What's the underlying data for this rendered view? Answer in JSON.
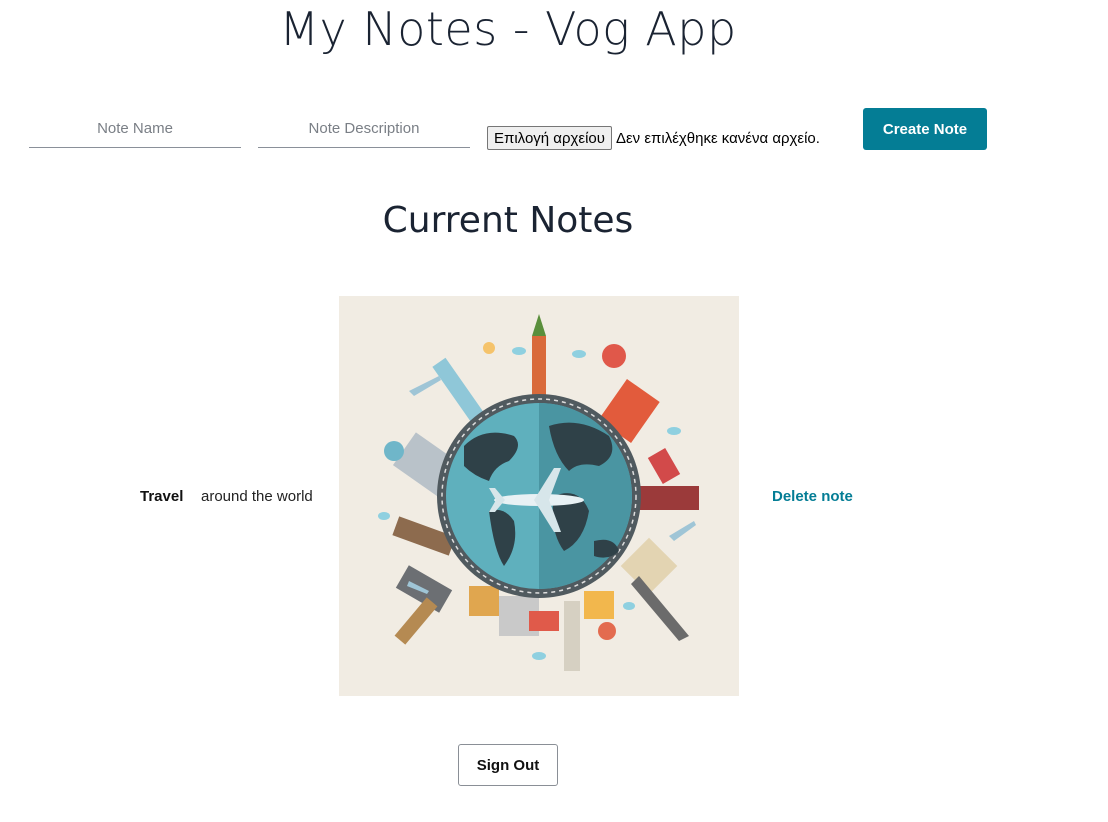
{
  "app": {
    "title": "My Notes - Vog App"
  },
  "form": {
    "name_placeholder": "Note Name",
    "description_placeholder": "Note Description",
    "file_button_label": "Επιλογή αρχείου",
    "file_status": "Δεν επιλέχθηκε κανένα αρχείο.",
    "create_label": "Create Note"
  },
  "notes_section": {
    "title": "Current Notes"
  },
  "notes": [
    {
      "name": "Travel",
      "description": "around the world",
      "image": "travel-globe-illustration",
      "delete_label": "Delete note"
    }
  ],
  "footer": {
    "sign_out_label": "Sign Out"
  },
  "colors": {
    "accent": "#047d95",
    "title_text": "#1a2332",
    "image_background": "#f1ece3"
  }
}
